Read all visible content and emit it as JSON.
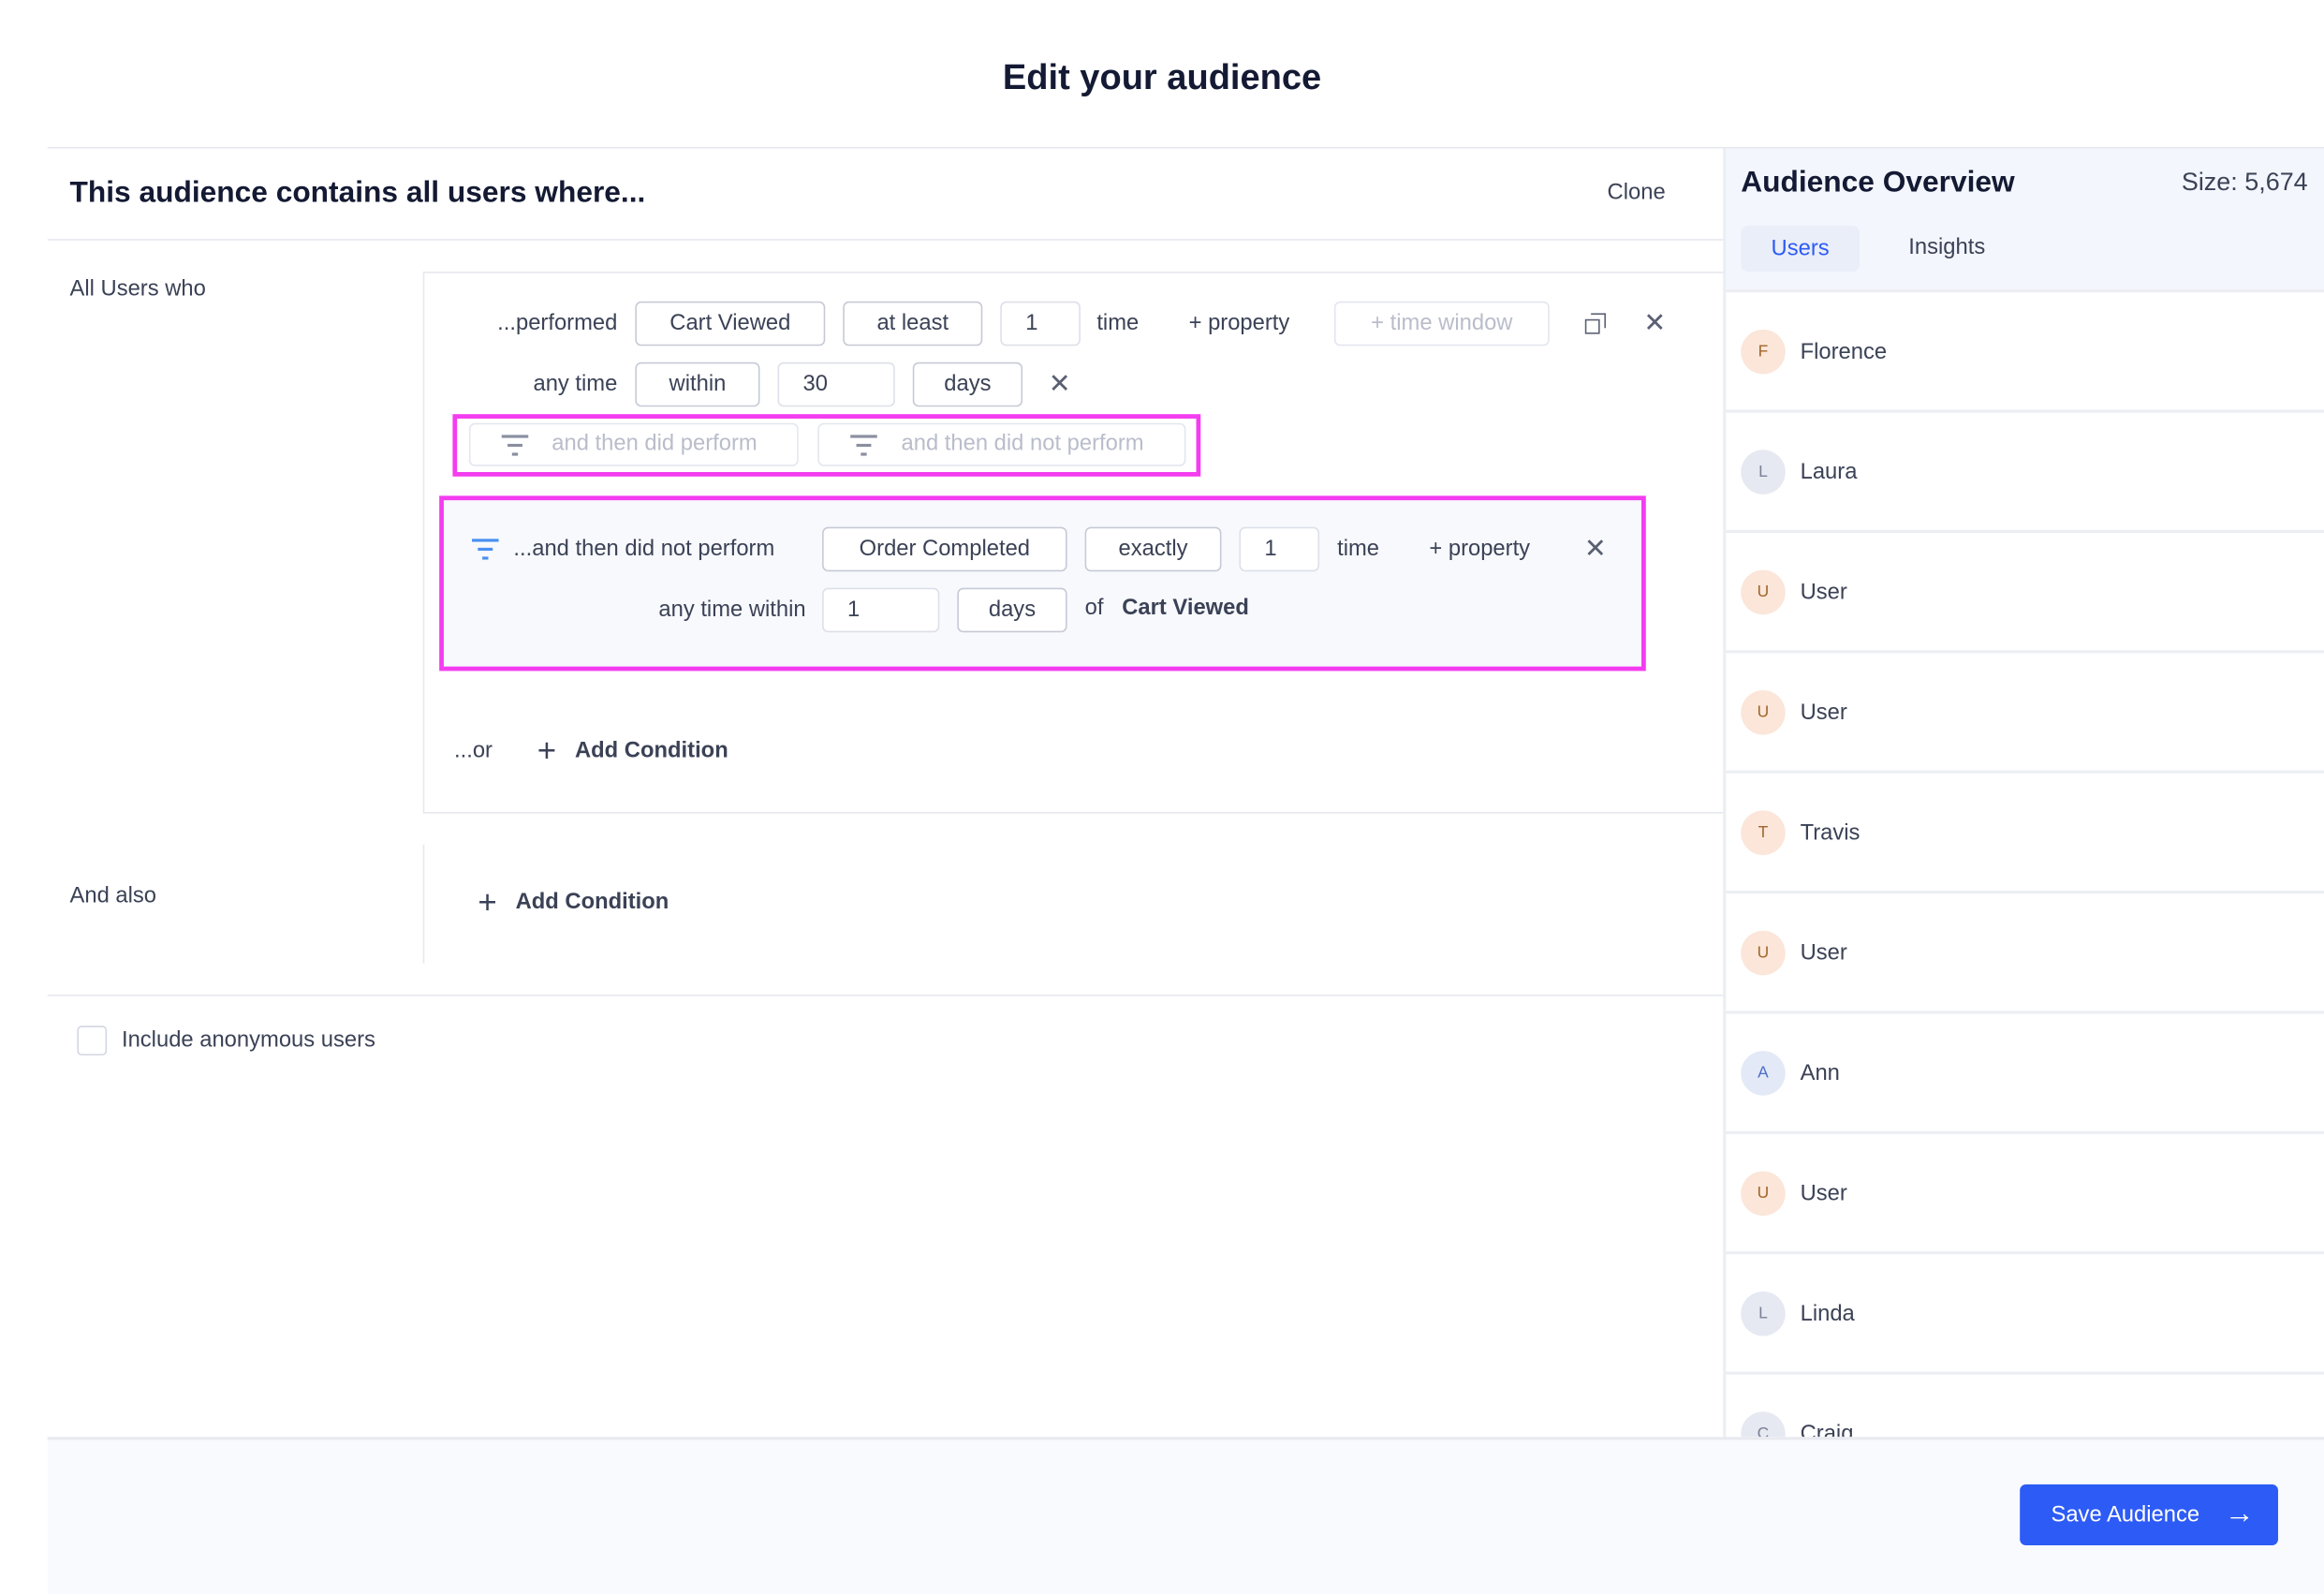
{
  "page_title": "Edit your audience",
  "builder": {
    "header": "This audience contains all users where...",
    "clone_label": "Clone",
    "all_users_label": "All Users who",
    "condition1": {
      "prefix": "...performed",
      "event": "Cart Viewed",
      "operator": "at least",
      "count": "1",
      "unit": "time",
      "add_property": "+ property",
      "add_time_window": "+ time window",
      "time_prefix": "any time",
      "time_operator": "within",
      "time_value": "30",
      "time_unit": "days"
    },
    "funnel_buttons": {
      "did_perform": "and then did perform",
      "did_not_perform": "and then did not perform"
    },
    "funnel_step": {
      "prefix": "...and then did not perform",
      "event": "Order Completed",
      "operator": "exactly",
      "count": "1",
      "unit": "time",
      "add_property": "+ property",
      "time_prefix": "any time within",
      "time_value": "1",
      "time_unit": "days",
      "of_label": "of",
      "ref_event": "Cart Viewed"
    },
    "or_label": "...or",
    "add_condition": "Add Condition",
    "and_also_label": "And also",
    "and_also_add_condition": "Add Condition",
    "anonymous_label": "Include anonymous users",
    "anonymous_checked": false
  },
  "overview": {
    "title": "Audience Overview",
    "size": "Size: 5,674",
    "tabs": [
      {
        "label": "Users",
        "active": true
      },
      {
        "label": "Insights",
        "active": false
      }
    ],
    "users": [
      {
        "initial": "F",
        "name": "Florence",
        "color": "#fbe6d9",
        "text": "#a0662c"
      },
      {
        "initial": "L",
        "name": "Laura",
        "color": "#e6e9f2",
        "text": "#7b8196"
      },
      {
        "initial": "U",
        "name": "User",
        "color": "#fbe6d9",
        "text": "#a0662c"
      },
      {
        "initial": "U",
        "name": "User",
        "color": "#fbe6d9",
        "text": "#a0662c"
      },
      {
        "initial": "T",
        "name": "Travis",
        "color": "#fbe6d9",
        "text": "#a0662c"
      },
      {
        "initial": "U",
        "name": "User",
        "color": "#fbe6d9",
        "text": "#a0662c"
      },
      {
        "initial": "A",
        "name": "Ann",
        "color": "#e3e9f6",
        "text": "#4e6fc9"
      },
      {
        "initial": "U",
        "name": "User",
        "color": "#fbe6d9",
        "text": "#a0662c"
      },
      {
        "initial": "L",
        "name": "Linda",
        "color": "#e6e9f2",
        "text": "#7b8196"
      },
      {
        "initial": "C",
        "name": "Craig",
        "color": "#e6e9f2",
        "text": "#7b8196"
      }
    ]
  },
  "footer": {
    "save_label": "Save Audience"
  },
  "colors": {
    "accent": "#2d5bf5",
    "highlight": "#f43cf0"
  }
}
